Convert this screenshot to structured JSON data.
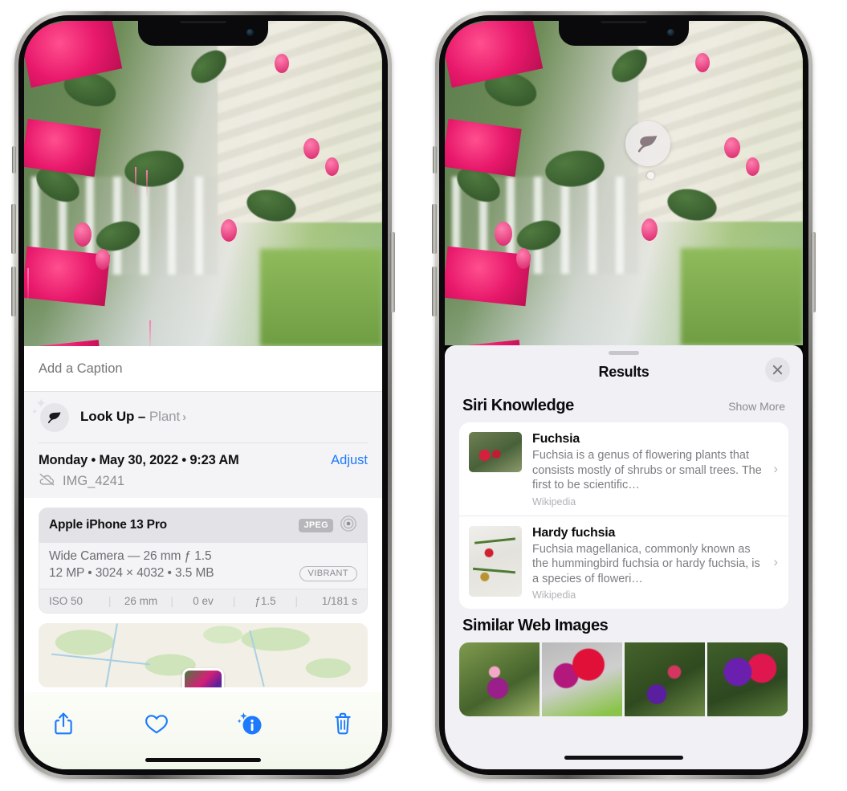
{
  "left_phone": {
    "device_name": "iPhone 13 Pro",
    "caption": {
      "placeholder": "Add a Caption",
      "value": ""
    },
    "lookup": {
      "icon": "leaf-icon",
      "label": "Look Up",
      "dash": " – ",
      "subject": "Plant",
      "chevron": "›"
    },
    "metadata": {
      "date_line": "Monday • May 30, 2022 • 9:23 AM",
      "adjust_label": "Adjust",
      "cloud_icon": "cloud-slash-icon",
      "filename": "IMG_4241"
    },
    "camera_card": {
      "model": "Apple iPhone 13 Pro",
      "format_badge": "JPEG",
      "lens_icon": "aperture-icon",
      "lens_line": "Wide Camera — 26 mm ƒ 1.5",
      "size_line": "12 MP • 3024 × 4032 • 3.5 MB",
      "style_pill": "VIBRANT",
      "exif": [
        "ISO 50",
        "26 mm",
        "0 ev",
        "ƒ1.5",
        "1/181 s"
      ]
    },
    "toolbar": [
      {
        "name": "share-button",
        "icon": "share-icon"
      },
      {
        "name": "favorite-button",
        "icon": "heart-icon"
      },
      {
        "name": "info-button",
        "icon": "info-sparkle-icon"
      },
      {
        "name": "delete-button",
        "icon": "trash-icon"
      }
    ]
  },
  "right_phone": {
    "visual_lookup_badge": {
      "icon": "leaf-icon"
    },
    "sheet": {
      "title": "Results",
      "close_icon": "close-icon",
      "siri_knowledge": {
        "title": "Siri Knowledge",
        "show_more": "Show More",
        "results": [
          {
            "title": "Fuchsia",
            "description": "Fuchsia is a genus of flowering plants that consists mostly of shrubs or small trees. The first to be scientific…",
            "source": "Wikipedia",
            "chevron": "›"
          },
          {
            "title": "Hardy fuchsia",
            "description": "Fuchsia magellanica, commonly known as the hummingbird fuchsia or hardy fuchsia, is a species of floweri…",
            "source": "Wikipedia",
            "chevron": "›"
          }
        ]
      },
      "similar_web_images": {
        "title": "Similar Web Images",
        "count": 4
      }
    }
  },
  "colors": {
    "accent_blue": "#1d7afc",
    "sheet_bg": "#f1f1f5",
    "card_bg": "#ffffff",
    "panel_gray": "#f4f4f7",
    "secondary_text": "#8e8e93"
  }
}
